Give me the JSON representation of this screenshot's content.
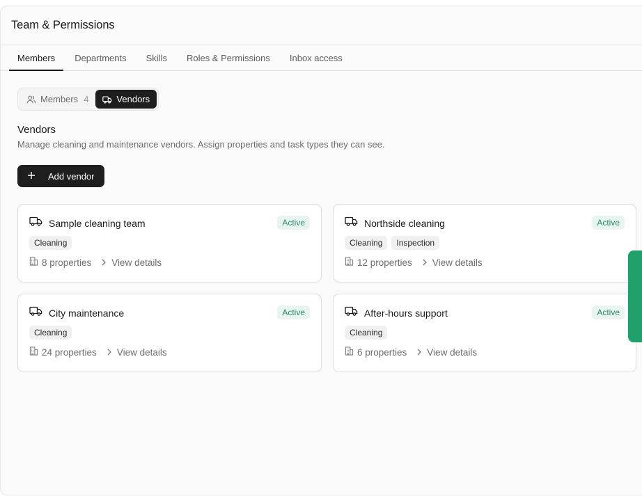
{
  "page": {
    "title": "Team & Permissions"
  },
  "tabs": [
    {
      "label": "Members",
      "active": true
    },
    {
      "label": "Departments",
      "active": false
    },
    {
      "label": "Skills",
      "active": false
    },
    {
      "label": "Roles & Permissions",
      "active": false
    },
    {
      "label": "Inbox access",
      "active": false
    }
  ],
  "segment": {
    "members_label": "Members",
    "members_count": "4",
    "vendors_label": "Vendors"
  },
  "section": {
    "title": "Vendors",
    "description": "Manage cleaning and maintenance vendors. Assign properties and task types they can see."
  },
  "add_button": {
    "label": "Add vendor"
  },
  "vendors": [
    {
      "name": "Sample cleaning team",
      "status": "Active",
      "tags": [
        "Cleaning"
      ],
      "properties": "8 properties",
      "details": "View details"
    },
    {
      "name": "Northside cleaning",
      "status": "Active",
      "tags": [
        "Cleaning",
        "Inspection"
      ],
      "properties": "12 properties",
      "details": "View details"
    },
    {
      "name": "City maintenance",
      "status": "Active",
      "tags": [
        "Cleaning"
      ],
      "properties": "24 properties",
      "details": "View details"
    },
    {
      "name": "After-hours support",
      "status": "Active",
      "tags": [
        "Cleaning"
      ],
      "properties": "6 properties",
      "details": "View details"
    }
  ],
  "colors": {
    "accent": "#1e1e1e",
    "active_badge_bg": "#e8f5ef",
    "active_badge_text": "#2c8a66",
    "feedback_tab": "#22a06b"
  }
}
